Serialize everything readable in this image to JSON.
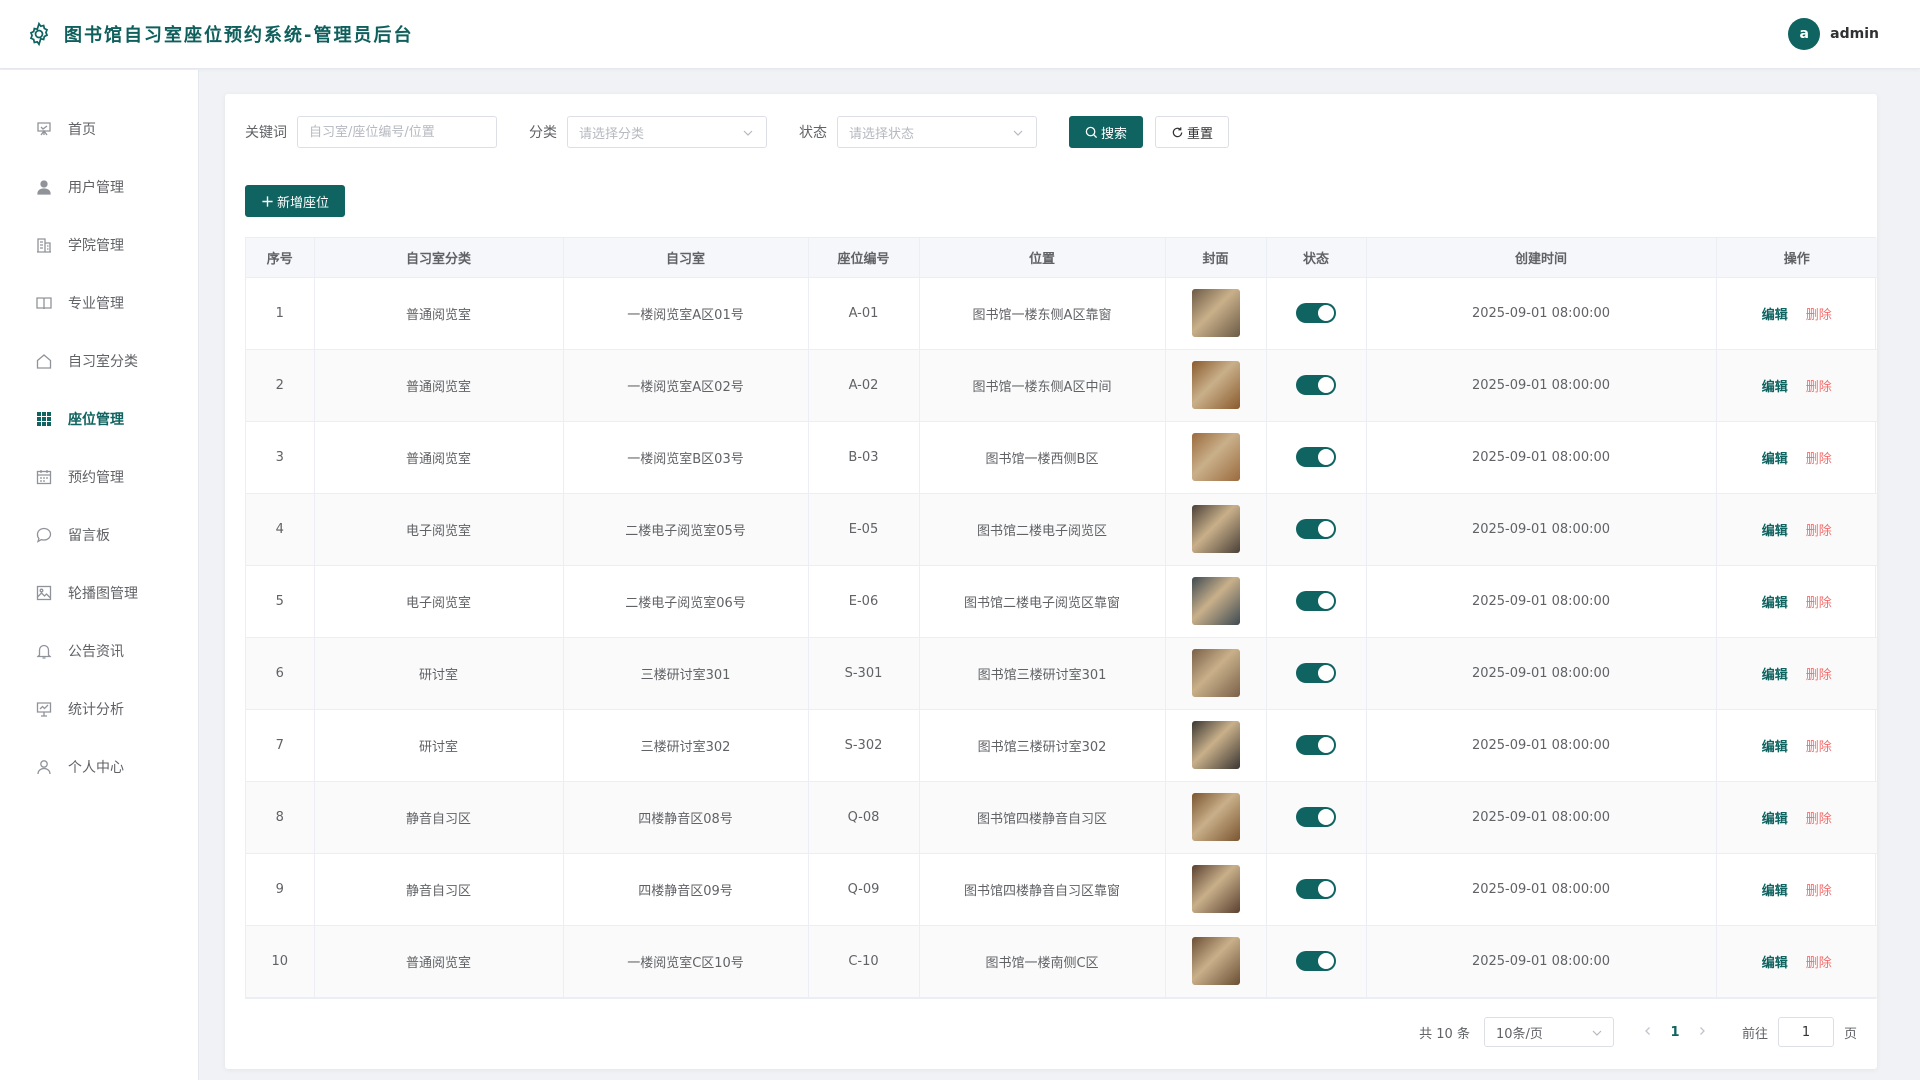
{
  "header": {
    "title": "图书馆自习室座位预约系统-管理员后台",
    "avatar_letter": "a",
    "username": "admin"
  },
  "sidebar": {
    "items": [
      {
        "label": "首页",
        "icon": "easel-icon",
        "active": false
      },
      {
        "label": "用户管理",
        "icon": "user-icon",
        "active": false
      },
      {
        "label": "学院管理",
        "icon": "building-icon",
        "active": false
      },
      {
        "label": "专业管理",
        "icon": "book-icon",
        "active": false
      },
      {
        "label": "自习室分类",
        "icon": "house-icon",
        "active": false
      },
      {
        "label": "座位管理",
        "icon": "grid-icon",
        "active": true
      },
      {
        "label": "预约管理",
        "icon": "calendar-icon",
        "active": false
      },
      {
        "label": "留言板",
        "icon": "chat-icon",
        "active": false
      },
      {
        "label": "轮播图管理",
        "icon": "image-icon",
        "active": false
      },
      {
        "label": "公告资讯",
        "icon": "bell-icon",
        "active": false
      },
      {
        "label": "统计分析",
        "icon": "chart-board-icon",
        "active": false
      },
      {
        "label": "个人中心",
        "icon": "person-icon",
        "active": false
      }
    ]
  },
  "filters": {
    "keyword_label": "关键词",
    "keyword_placeholder": "自习室/座位编号/位置",
    "category_label": "分类",
    "category_placeholder": "请选择分类",
    "status_label": "状态",
    "status_placeholder": "请选择状态",
    "search_label": "搜索",
    "reset_label": "重置"
  },
  "actions": {
    "add_label": "新增座位"
  },
  "table": {
    "columns": [
      "序号",
      "自习室分类",
      "自习室",
      "座位编号",
      "位置",
      "封面",
      "状态",
      "创建时间",
      "操作"
    ],
    "edit_label": "编辑",
    "delete_label": "删除",
    "rows": [
      {
        "no": "1",
        "category": "普通阅览室",
        "room": "一楼阅览室A区01号",
        "seat": "A-01",
        "location": "图书馆一楼东侧A区靠窗",
        "status": true,
        "created": "2025-09-01 08:00:00",
        "thumb": "#6b5a45"
      },
      {
        "no": "2",
        "category": "普通阅览室",
        "room": "一楼阅览室A区02号",
        "seat": "A-02",
        "location": "图书馆一楼东侧A区中间",
        "status": true,
        "created": "2025-09-01 08:00:00",
        "thumb": "#8a5a2e"
      },
      {
        "no": "3",
        "category": "普通阅览室",
        "room": "一楼阅览室B区03号",
        "seat": "B-03",
        "location": "图书馆一楼西侧B区",
        "status": true,
        "created": "2025-09-01 08:00:00",
        "thumb": "#9b6a3e"
      },
      {
        "no": "4",
        "category": "电子阅览室",
        "room": "二楼电子阅览室05号",
        "seat": "E-05",
        "location": "图书馆二楼电子阅览区",
        "status": true,
        "created": "2025-09-01 08:00:00",
        "thumb": "#4a4038"
      },
      {
        "no": "5",
        "category": "电子阅览室",
        "room": "二楼电子阅览室06号",
        "seat": "E-06",
        "location": "图书馆二楼电子阅览区靠窗",
        "status": true,
        "created": "2025-09-01 08:00:00",
        "thumb": "#3e4a52"
      },
      {
        "no": "6",
        "category": "研讨室",
        "room": "三楼研讨室301",
        "seat": "S-301",
        "location": "图书馆三楼研讨室301",
        "status": true,
        "created": "2025-09-01 08:00:00",
        "thumb": "#7a6048"
      },
      {
        "no": "7",
        "category": "研讨室",
        "room": "三楼研讨室302",
        "seat": "S-302",
        "location": "图书馆三楼研讨室302",
        "status": true,
        "created": "2025-09-01 08:00:00",
        "thumb": "#3a3632"
      },
      {
        "no": "8",
        "category": "静音自习区",
        "room": "四楼静音区08号",
        "seat": "Q-08",
        "location": "图书馆四楼静音自习区",
        "status": true,
        "created": "2025-09-01 08:00:00",
        "thumb": "#7a5530"
      },
      {
        "no": "9",
        "category": "静音自习区",
        "room": "四楼静音区09号",
        "seat": "Q-09",
        "location": "图书馆四楼静音自习区靠窗",
        "status": true,
        "created": "2025-09-01 08:00:00",
        "thumb": "#5a4030"
      },
      {
        "no": "10",
        "category": "普通阅览室",
        "room": "一楼阅览室C区10号",
        "seat": "C-10",
        "location": "图书馆一楼南侧C区",
        "status": true,
        "created": "2025-09-01 08:00:00",
        "thumb": "#6a4e34"
      }
    ]
  },
  "pagination": {
    "total_text": "共 10 条",
    "page_size": "10条/页",
    "current_page": "1",
    "goto_label": "前往",
    "goto_value": "1",
    "page_unit": "页"
  },
  "colors": {
    "primary": "#0f6360",
    "danger": "#f56c6c"
  }
}
